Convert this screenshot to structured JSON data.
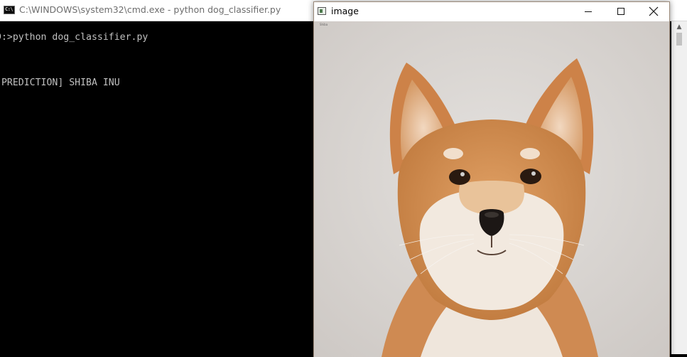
{
  "cmd": {
    "title": "C:\\WINDOWS\\system32\\cmd.exe - python  dog_classifier.py",
    "icon_text": "C:\\",
    "lines": [
      "D:>python dog_classifier.py",
      "[PREDICTION] SHIBA INU"
    ]
  },
  "image_window": {
    "title": "image",
    "tiny_label": "Shiba"
  },
  "colors": {
    "console_bg": "#000000",
    "console_text": "#c0c0c0",
    "photo_bg": "#dcd8d5",
    "fur_orange": "#d28a4e",
    "fur_cream": "#f0e8df"
  }
}
